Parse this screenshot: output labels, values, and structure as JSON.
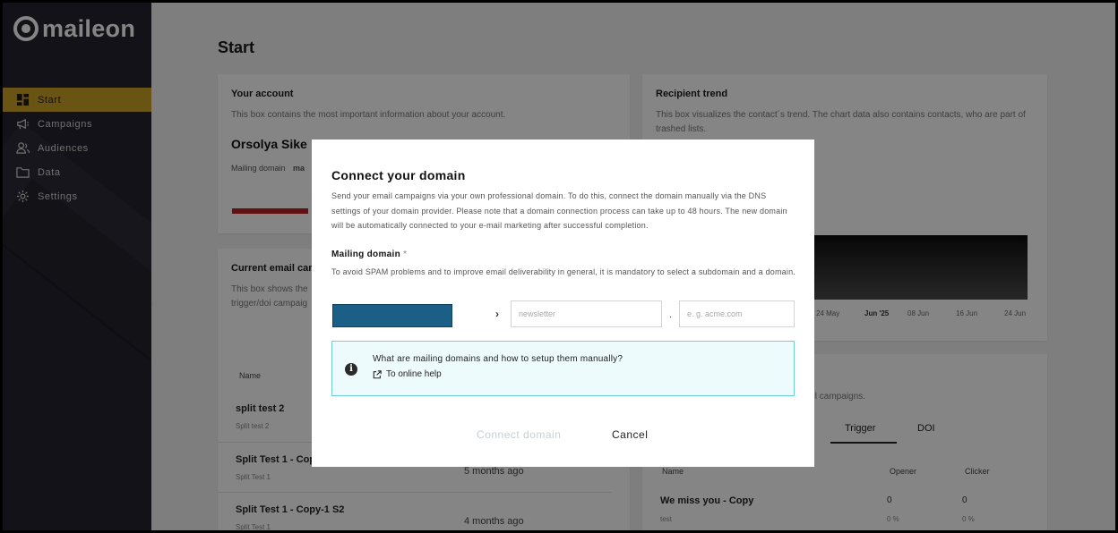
{
  "app": {
    "logo_text": "maileon"
  },
  "sidebar": {
    "items": [
      {
        "label": "Start",
        "icon": "dashboard-icon"
      },
      {
        "label": "Campaigns",
        "icon": "megaphone-icon"
      },
      {
        "label": "Audiences",
        "icon": "users-icon"
      },
      {
        "label": "Data",
        "icon": "folder-icon"
      },
      {
        "label": "Settings",
        "icon": "gear-icon"
      }
    ],
    "active": "Start",
    "toggle": "‹"
  },
  "page": {
    "title": "Start"
  },
  "account_card": {
    "title": "Your account",
    "desc": "This box contains the most important information about your account.",
    "name": "Orsolya Sike",
    "mailing_domain_label": "Mailing domain",
    "mailing_domain_value": "ma"
  },
  "trend_card": {
    "title": "Recipient trend",
    "desc": "This box visualizes the contact´s trend. The chart data also contains contacts, who are part of trashed lists.",
    "ticks": [
      "24 May",
      "Jun '25",
      "08 Jun",
      "16 Jun",
      "24 Jun"
    ]
  },
  "campaign_card": {
    "title": "Current email cam",
    "desc": "This box shows the",
    "desc2": "trigger/doi campaig",
    "col_name": "Name",
    "rows": [
      {
        "title": "split test 2",
        "sub": "Split test 2",
        "date": ""
      },
      {
        "title": "Split Test 1 - Cop",
        "sub": "Split Test 1",
        "date": "5 months ago"
      },
      {
        "title": "Split Test 1 - Copy-1 S2",
        "sub": "Split Test 1",
        "date": "4 months ago"
      }
    ]
  },
  "trigger_card": {
    "desc": "ail campaigns.",
    "tabs": [
      "Trigger",
      "DOI"
    ],
    "col_name": "Name",
    "col_opener": "Opener",
    "col_clicker": "Clicker",
    "row": {
      "title": "We miss you - Copy",
      "sub": "test",
      "opener": "0",
      "clicker": "0",
      "opener_pct": "0 %",
      "clicker_pct": "0 %"
    }
  },
  "modal": {
    "title": "Connect your domain",
    "desc": "Send your email campaigns via your own professional domain. To do this, connect the domain manually via the DNS settings of your domain provider. Please note that a domain connection process can take up to 48 hours. The new domain will be automatically connected to your e-mail marketing after successful completion.",
    "field_label": "Mailing domain",
    "required_mark": "*",
    "field_help": "To avoid SPAM problems and to improve email deliverability in general, it is mandatory to select a subdomain and a domain.",
    "subdomain_placeholder": "newsletter",
    "domain_placeholder": "e. g. acme.com",
    "separator": ".",
    "chevron": "›",
    "info_question": "What are mailing domains and how to setup them manually?",
    "info_link": "To online help",
    "connect_label": "Connect domain",
    "cancel_label": "Cancel"
  },
  "colors": {
    "sidebar_bg": "#23232f",
    "active_nav": "#c9a227",
    "select_fill": "#1c5f86",
    "info_border": "#6fd0da",
    "info_bg": "#eefbfc"
  }
}
